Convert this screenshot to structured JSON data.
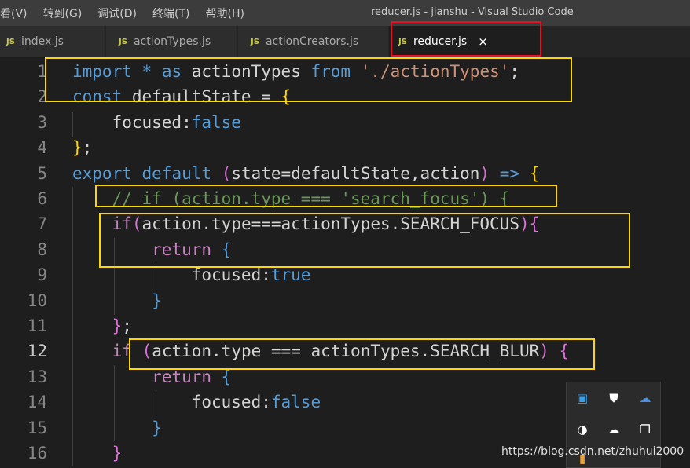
{
  "menu": {
    "items": [
      "看(V)",
      "转到(G)",
      "调试(D)",
      "终端(T)",
      "帮助(H)"
    ]
  },
  "window_title": "reducer.js - jianshu - Visual Studio Code",
  "tabs": [
    {
      "icon": "JS",
      "label": "index.js",
      "active": false
    },
    {
      "icon": "JS",
      "label": "actionTypes.js",
      "active": false
    },
    {
      "icon": "JS",
      "label": "actionCreators.js",
      "active": false
    },
    {
      "icon": "JS",
      "label": "reducer.js",
      "active": true,
      "close": "×"
    }
  ],
  "editor": {
    "current_line": 12,
    "line_numbers": [
      "1",
      "2",
      "3",
      "4",
      "5",
      "6",
      "7",
      "8",
      "9",
      "10",
      "11",
      "12",
      "13",
      "14",
      "15",
      "16"
    ],
    "lines": [
      [
        [
          "kw",
          "import"
        ],
        [
          "var",
          " "
        ],
        [
          "kw",
          "*"
        ],
        [
          "var",
          " "
        ],
        [
          "kw",
          "as"
        ],
        [
          "var",
          " actionTypes "
        ],
        [
          "kw",
          "from"
        ],
        [
          "var",
          " "
        ],
        [
          "str",
          "'./actionTypes'"
        ],
        [
          "var",
          ";"
        ]
      ],
      [
        [
          "kw",
          "const"
        ],
        [
          "var",
          " defaultState = "
        ],
        [
          "brace",
          "{"
        ]
      ],
      [
        [
          "var",
          "    focused:"
        ],
        [
          "bool",
          "false"
        ]
      ],
      [
        [
          "brace",
          "}"
        ],
        [
          "var",
          ";"
        ]
      ],
      [
        [
          "kw",
          "export"
        ],
        [
          "var",
          " "
        ],
        [
          "kw",
          "default"
        ],
        [
          "var",
          " "
        ],
        [
          "paren",
          "("
        ],
        [
          "var",
          "state=defaultState,action"
        ],
        [
          "paren",
          ")"
        ],
        [
          "var",
          " "
        ],
        [
          "kw",
          "=>"
        ],
        [
          "var",
          " "
        ],
        [
          "brace",
          "{"
        ]
      ],
      [
        [
          "var",
          "    "
        ],
        [
          "cmt",
          "// if (action.type === 'search_focus') {"
        ]
      ],
      [
        [
          "var",
          "    "
        ],
        [
          "kw2",
          "if"
        ],
        [
          "paren",
          "("
        ],
        [
          "var",
          "action.type===actionTypes.SEARCH_FOCUS"
        ],
        [
          "paren",
          ")"
        ],
        [
          "paren",
          "{"
        ]
      ],
      [
        [
          "var",
          "        "
        ],
        [
          "kw2",
          "return"
        ],
        [
          "var",
          " "
        ],
        [
          "kw",
          "{"
        ]
      ],
      [
        [
          "var",
          "            focused:"
        ],
        [
          "bool",
          "true"
        ]
      ],
      [
        [
          "var",
          "        "
        ],
        [
          "kw",
          "}"
        ]
      ],
      [
        [
          "var",
          "    "
        ],
        [
          "paren",
          "}"
        ],
        [
          "var",
          ";"
        ]
      ],
      [
        [
          "var",
          "    "
        ],
        [
          "kw2",
          "if"
        ],
        [
          "var",
          " "
        ],
        [
          "paren",
          "("
        ],
        [
          "var",
          "action.type === actionTypes.SEARCH_BLUR"
        ],
        [
          "paren",
          ")"
        ],
        [
          "var",
          " "
        ],
        [
          "paren",
          "{"
        ]
      ],
      [
        [
          "var",
          "        "
        ],
        [
          "kw2",
          "return"
        ],
        [
          "var",
          " "
        ],
        [
          "kw",
          "{"
        ]
      ],
      [
        [
          "var",
          "            focused:"
        ],
        [
          "bool",
          "false"
        ]
      ],
      [
        [
          "var",
          "        "
        ],
        [
          "kw",
          "}"
        ]
      ],
      [
        [
          "var",
          "    "
        ],
        [
          "paren",
          "}"
        ]
      ]
    ]
  },
  "tray": {
    "icons": [
      "network-monitor-icon",
      "defender-shield-icon",
      "baidu-cloud-icon",
      "mute-icon",
      "onedrive-icon",
      "copy-icon",
      "app-icon"
    ]
  },
  "watermark": "https://blog.csdn.net/zhuhui2000"
}
